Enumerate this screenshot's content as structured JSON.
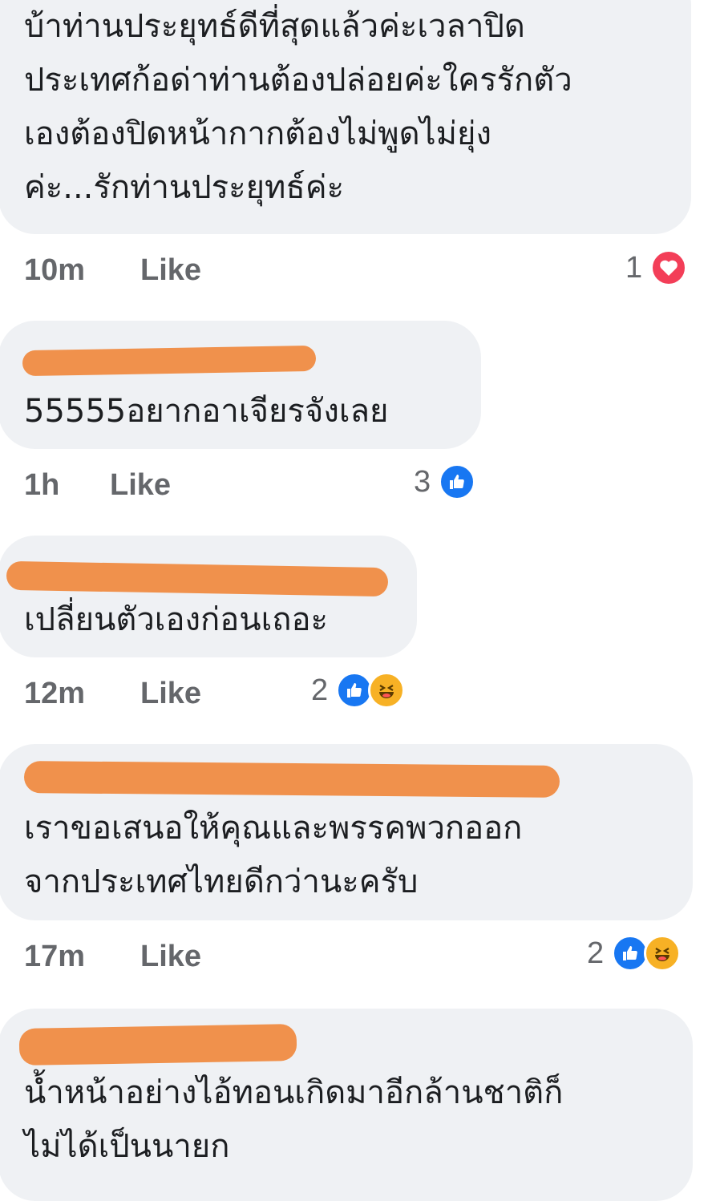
{
  "comments": [
    {
      "text": "บ้าท่านประยุทธ์ดีที่สุดแล้วค่ะเวลาปิด\nประเทศก้อด่าท่านต้องปล่อยค่ะใครรักตัว\nเองต้องปิดหน้ากากต้องไม่พูดไม่ยุ่ง\nค่ะ...รักท่านประยุทธ์ค่ะ",
      "time": "10m",
      "like_label": "Like",
      "reaction_count": "1",
      "reactions": [
        "love-icon"
      ]
    },
    {
      "text": "55555อยากอาเจียรจังเลย",
      "time": "1h",
      "like_label": "Like",
      "reaction_count": "3",
      "reactions": [
        "like-icon"
      ]
    },
    {
      "text": "เปลี่ยนตัวเองก่อนเถอะ",
      "time": "12m",
      "like_label": "Like",
      "reaction_count": "2",
      "reactions": [
        "like-icon",
        "haha-icon"
      ]
    },
    {
      "text": "เราขอเสนอให้คุณและพรรคพวกออก\nจากประเทศไทยดีกว่านะครับ",
      "time": "17m",
      "like_label": "Like",
      "reaction_count": "2",
      "reactions": [
        "like-icon",
        "haha-icon"
      ]
    },
    {
      "text": "น้ำหน้าอย่างไอ้ทอนเกิดมาอีกล้านชาติก็\nไม่ได้เป็นนายก"
    }
  ],
  "colors": {
    "bubble": "#eff1f4",
    "meta_text": "#65676b",
    "redaction": "#f0914c",
    "like_blue": "#1877f2",
    "love_red": "#f33e58",
    "haha_yellow": "#f7b125"
  }
}
